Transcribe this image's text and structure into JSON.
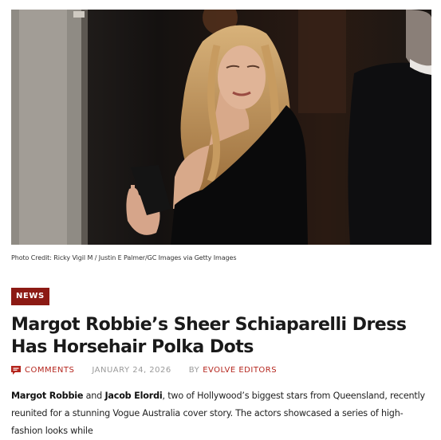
{
  "photo": {
    "alt": "Margot Robbie in a black one-shoulder dress",
    "credit": "Photo Credit: Ricky Vigil M / Justin E Palmer/GC Images via Getty Images"
  },
  "article": {
    "category": "NEWS",
    "title": "Margot Robbie’s Sheer Schiaparelli Dress Has Horsehair Polka Dots",
    "comments_label": "COMMENTS",
    "date": "JANUARY 24, 2026",
    "by_label": "BY",
    "author": "EVOLVE EDITORS",
    "intro": {
      "name1": "Margot Robbie",
      "and": " and ",
      "name2": "Jacob Elordi",
      "rest": ", two of Hollywood’s biggest stars from Queensland, recently reunited for a stunning Vogue Australia cover story. The actors showcased a series of high-fashion looks while"
    }
  },
  "colors": {
    "accent": "#b5261e",
    "tag_bg": "#8c1a14"
  }
}
